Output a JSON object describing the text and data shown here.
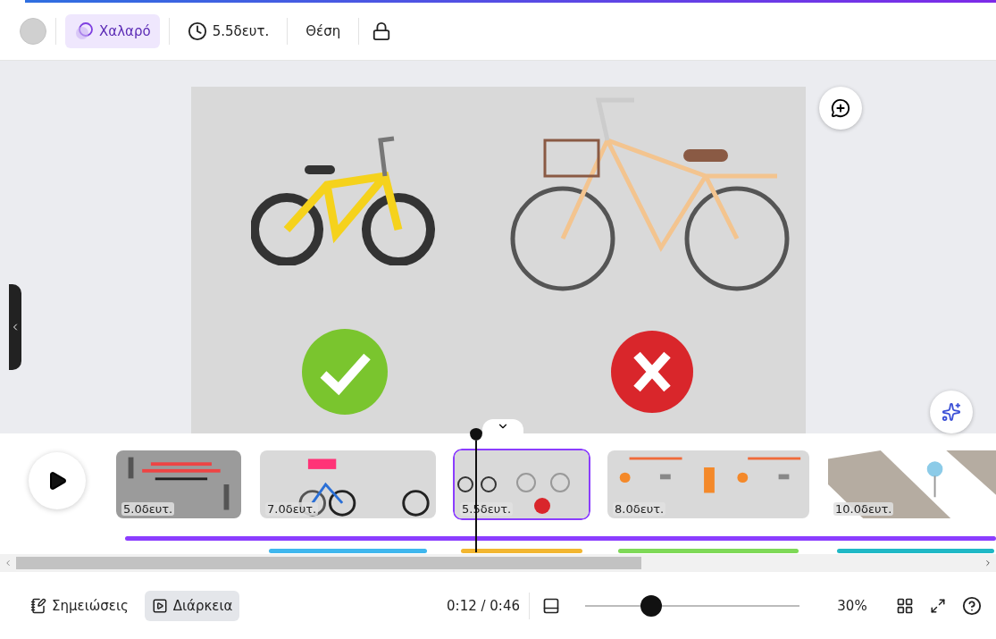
{
  "toolbar": {
    "animation": {
      "label": "Χαλαρό",
      "selected": true
    },
    "duration": "5.5δευτ.",
    "position": "Θέση"
  },
  "slide": {
    "marks": [
      {
        "kind": "correct"
      },
      {
        "kind": "wrong"
      }
    ]
  },
  "timeline": {
    "clips": [
      {
        "duration": "5.0δευτ.",
        "selected": false,
        "kind": "title"
      },
      {
        "duration": "7.0δευτ.",
        "selected": false,
        "kind": "bikes",
        "color": "#3fb7ee"
      },
      {
        "duration": "5.5δευτ.",
        "selected": true,
        "kind": "choice",
        "color": "#f2b630"
      },
      {
        "duration": "8.0δευτ.",
        "selected": false,
        "kind": "gear",
        "color": "#7ed957"
      },
      {
        "duration": "10.0δευτ.",
        "selected": false,
        "kind": "road",
        "color": "#1fb8c6"
      }
    ]
  },
  "footer": {
    "notes": "Σημειώσεις",
    "duration": {
      "label": "Διάρκεια",
      "selected": true
    },
    "time": "0:12 / 0:46",
    "zoom": {
      "level": 0.31,
      "reading": "30%"
    }
  }
}
